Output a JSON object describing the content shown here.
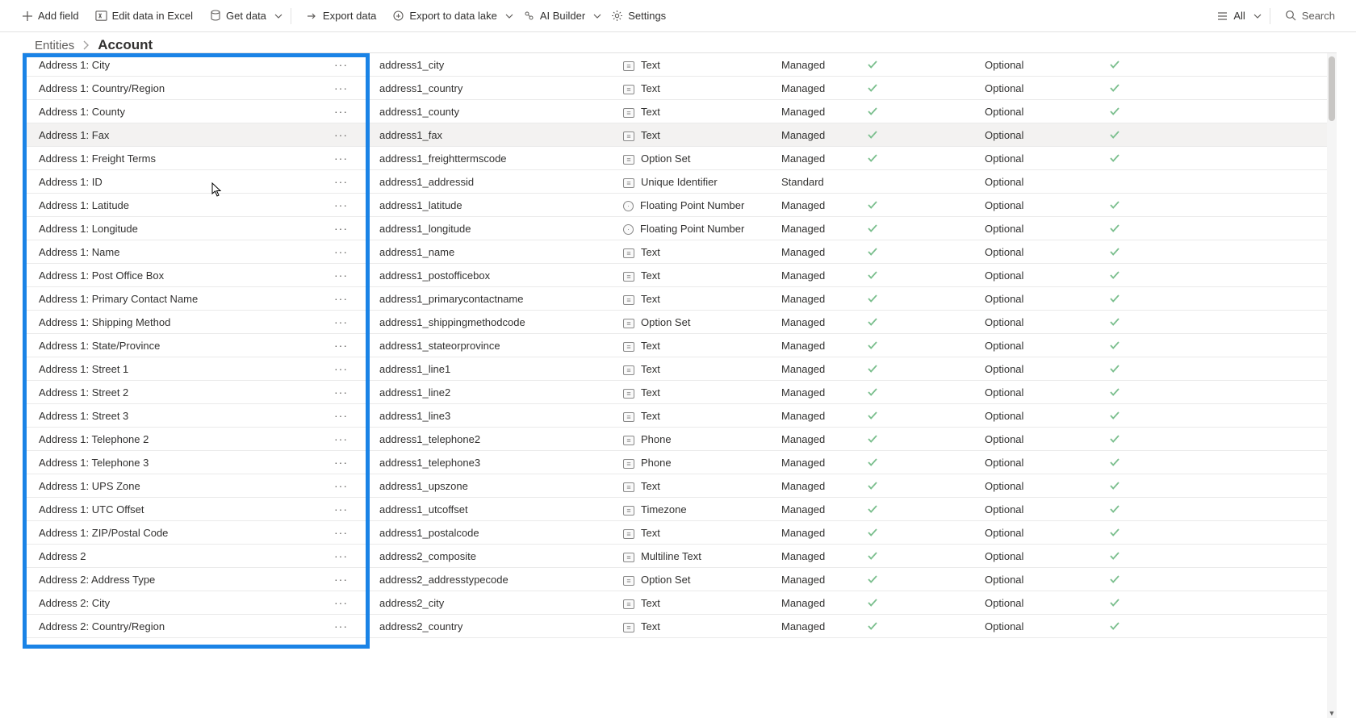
{
  "toolbar": {
    "add_field": "Add field",
    "edit_excel": "Edit data in Excel",
    "get_data": "Get data",
    "export_data": "Export data",
    "export_lake": "Export to data lake",
    "ai_builder": "AI Builder",
    "settings": "Settings",
    "all": "All",
    "search_placeholder": "Search"
  },
  "breadcrumb": {
    "root": "Entities",
    "current": "Account"
  },
  "typeLabels": {
    "text": "Text",
    "optionset": "Option Set",
    "unique": "Unique Identifier",
    "float": "Floating Point Number",
    "phone": "Phone",
    "timezone": "Timezone",
    "multiline": "Multiline Text"
  },
  "rows": [
    {
      "display": "Address 1: City",
      "name": "address1_city",
      "type": "text",
      "kind": "Managed",
      "check": true,
      "req": "Optional",
      "check2": true,
      "hovered": false
    },
    {
      "display": "Address 1: Country/Region",
      "name": "address1_country",
      "type": "text",
      "kind": "Managed",
      "check": true,
      "req": "Optional",
      "check2": true,
      "hovered": false
    },
    {
      "display": "Address 1: County",
      "name": "address1_county",
      "type": "text",
      "kind": "Managed",
      "check": true,
      "req": "Optional",
      "check2": true,
      "hovered": false
    },
    {
      "display": "Address 1: Fax",
      "name": "address1_fax",
      "type": "text",
      "kind": "Managed",
      "check": true,
      "req": "Optional",
      "check2": true,
      "hovered": true
    },
    {
      "display": "Address 1: Freight Terms",
      "name": "address1_freighttermscode",
      "type": "optionset",
      "kind": "Managed",
      "check": true,
      "req": "Optional",
      "check2": true,
      "hovered": false
    },
    {
      "display": "Address 1: ID",
      "name": "address1_addressid",
      "type": "unique",
      "kind": "Standard",
      "check": false,
      "req": "Optional",
      "check2": false,
      "hovered": false
    },
    {
      "display": "Address 1: Latitude",
      "name": "address1_latitude",
      "type": "float",
      "kind": "Managed",
      "check": true,
      "req": "Optional",
      "check2": true,
      "hovered": false
    },
    {
      "display": "Address 1: Longitude",
      "name": "address1_longitude",
      "type": "float",
      "kind": "Managed",
      "check": true,
      "req": "Optional",
      "check2": true,
      "hovered": false
    },
    {
      "display": "Address 1: Name",
      "name": "address1_name",
      "type": "text",
      "kind": "Managed",
      "check": true,
      "req": "Optional",
      "check2": true,
      "hovered": false
    },
    {
      "display": "Address 1: Post Office Box",
      "name": "address1_postofficebox",
      "type": "text",
      "kind": "Managed",
      "check": true,
      "req": "Optional",
      "check2": true,
      "hovered": false
    },
    {
      "display": "Address 1: Primary Contact Name",
      "name": "address1_primarycontactname",
      "type": "text",
      "kind": "Managed",
      "check": true,
      "req": "Optional",
      "check2": true,
      "hovered": false
    },
    {
      "display": "Address 1: Shipping Method",
      "name": "address1_shippingmethodcode",
      "type": "optionset",
      "kind": "Managed",
      "check": true,
      "req": "Optional",
      "check2": true,
      "hovered": false
    },
    {
      "display": "Address 1: State/Province",
      "name": "address1_stateorprovince",
      "type": "text",
      "kind": "Managed",
      "check": true,
      "req": "Optional",
      "check2": true,
      "hovered": false
    },
    {
      "display": "Address 1: Street 1",
      "name": "address1_line1",
      "type": "text",
      "kind": "Managed",
      "check": true,
      "req": "Optional",
      "check2": true,
      "hovered": false
    },
    {
      "display": "Address 1: Street 2",
      "name": "address1_line2",
      "type": "text",
      "kind": "Managed",
      "check": true,
      "req": "Optional",
      "check2": true,
      "hovered": false
    },
    {
      "display": "Address 1: Street 3",
      "name": "address1_line3",
      "type": "text",
      "kind": "Managed",
      "check": true,
      "req": "Optional",
      "check2": true,
      "hovered": false
    },
    {
      "display": "Address 1: Telephone 2",
      "name": "address1_telephone2",
      "type": "phone",
      "kind": "Managed",
      "check": true,
      "req": "Optional",
      "check2": true,
      "hovered": false
    },
    {
      "display": "Address 1: Telephone 3",
      "name": "address1_telephone3",
      "type": "phone",
      "kind": "Managed",
      "check": true,
      "req": "Optional",
      "check2": true,
      "hovered": false
    },
    {
      "display": "Address 1: UPS Zone",
      "name": "address1_upszone",
      "type": "text",
      "kind": "Managed",
      "check": true,
      "req": "Optional",
      "check2": true,
      "hovered": false
    },
    {
      "display": "Address 1: UTC Offset",
      "name": "address1_utcoffset",
      "type": "timezone",
      "kind": "Managed",
      "check": true,
      "req": "Optional",
      "check2": true,
      "hovered": false
    },
    {
      "display": "Address 1: ZIP/Postal Code",
      "name": "address1_postalcode",
      "type": "text",
      "kind": "Managed",
      "check": true,
      "req": "Optional",
      "check2": true,
      "hovered": false
    },
    {
      "display": "Address 2",
      "name": "address2_composite",
      "type": "multiline",
      "kind": "Managed",
      "check": true,
      "req": "Optional",
      "check2": true,
      "hovered": false
    },
    {
      "display": "Address 2: Address Type",
      "name": "address2_addresstypecode",
      "type": "optionset",
      "kind": "Managed",
      "check": true,
      "req": "Optional",
      "check2": true,
      "hovered": false
    },
    {
      "display": "Address 2: City",
      "name": "address2_city",
      "type": "text",
      "kind": "Managed",
      "check": true,
      "req": "Optional",
      "check2": true,
      "hovered": false
    },
    {
      "display": "Address 2: Country/Region",
      "name": "address2_country",
      "type": "text",
      "kind": "Managed",
      "check": true,
      "req": "Optional",
      "check2": true,
      "hovered": false
    }
  ]
}
